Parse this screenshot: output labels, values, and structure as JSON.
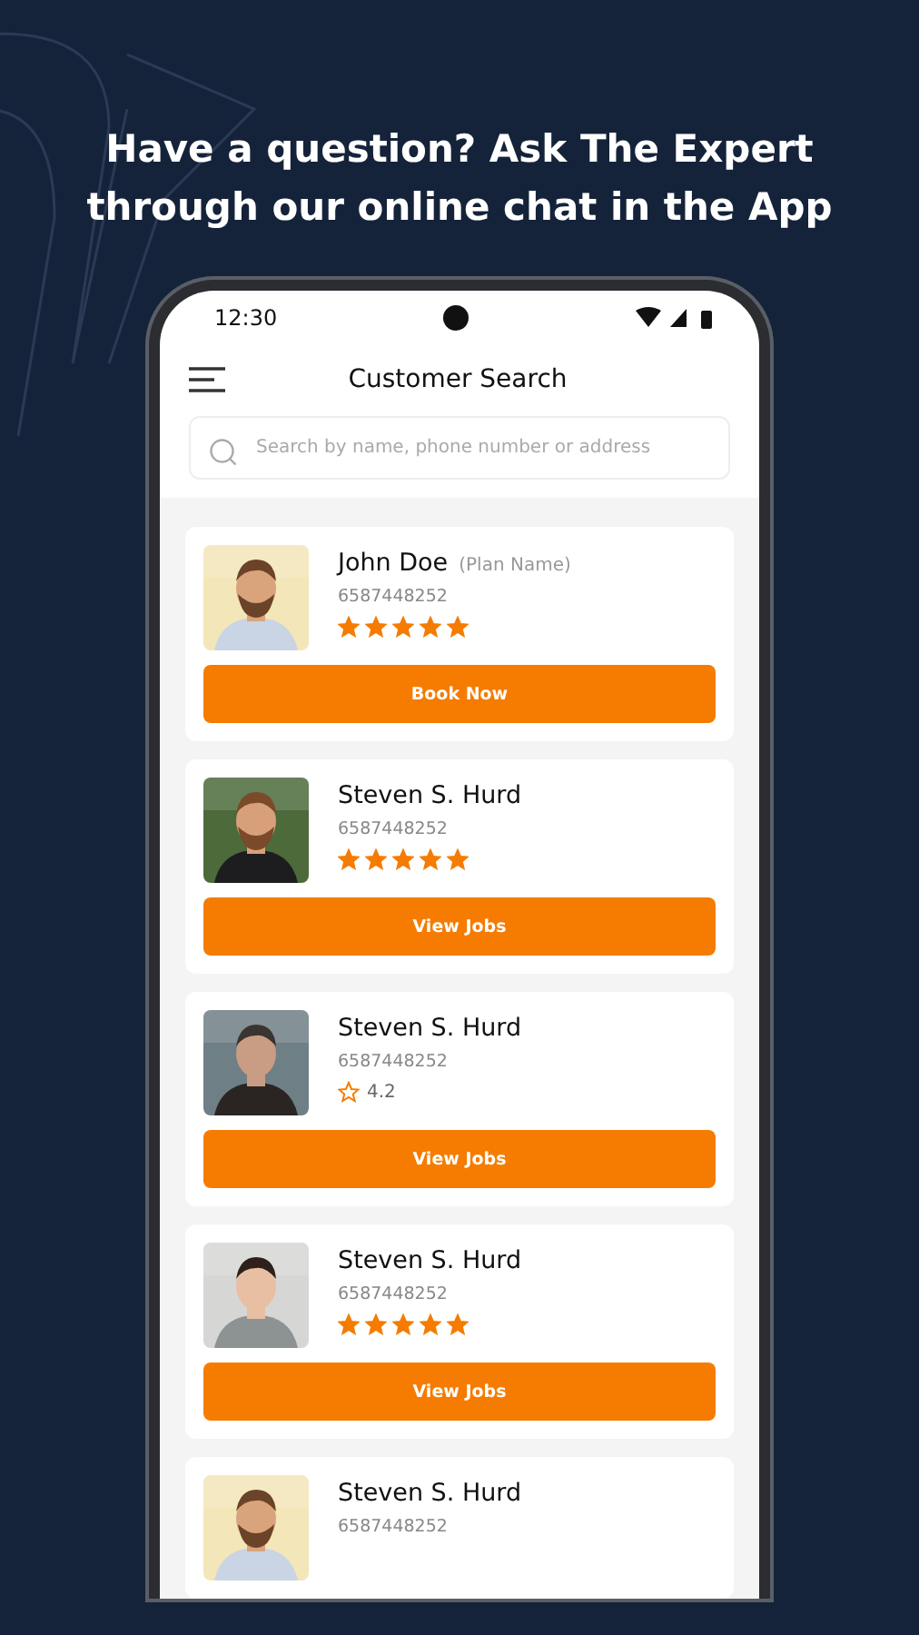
{
  "headline": "Have a question? Ask The Expert through our online chat in the App",
  "status_bar": {
    "time": "12:30"
  },
  "header": {
    "title": "Customer Search"
  },
  "search": {
    "placeholder": "Search by name, phone number or address"
  },
  "customers": [
    {
      "name": "John Doe",
      "plan": "(Plan Name)",
      "phone": "6587448252",
      "rating": {
        "kind": "stars",
        "stars": 5
      },
      "action": "Book Now"
    },
    {
      "name": "Steven S. Hurd",
      "phone": "6587448252",
      "rating": {
        "kind": "stars",
        "stars": 5
      },
      "action": "View Jobs"
    },
    {
      "name": "Steven S. Hurd",
      "phone": "6587448252",
      "rating": {
        "kind": "score",
        "score": "4.2"
      },
      "action": "View Jobs"
    },
    {
      "name": "Steven S. Hurd",
      "phone": "6587448252",
      "rating": {
        "kind": "stars",
        "stars": 5
      },
      "action": "View Jobs"
    },
    {
      "name": "Steven S. Hurd",
      "phone": "6587448252"
    }
  ]
}
